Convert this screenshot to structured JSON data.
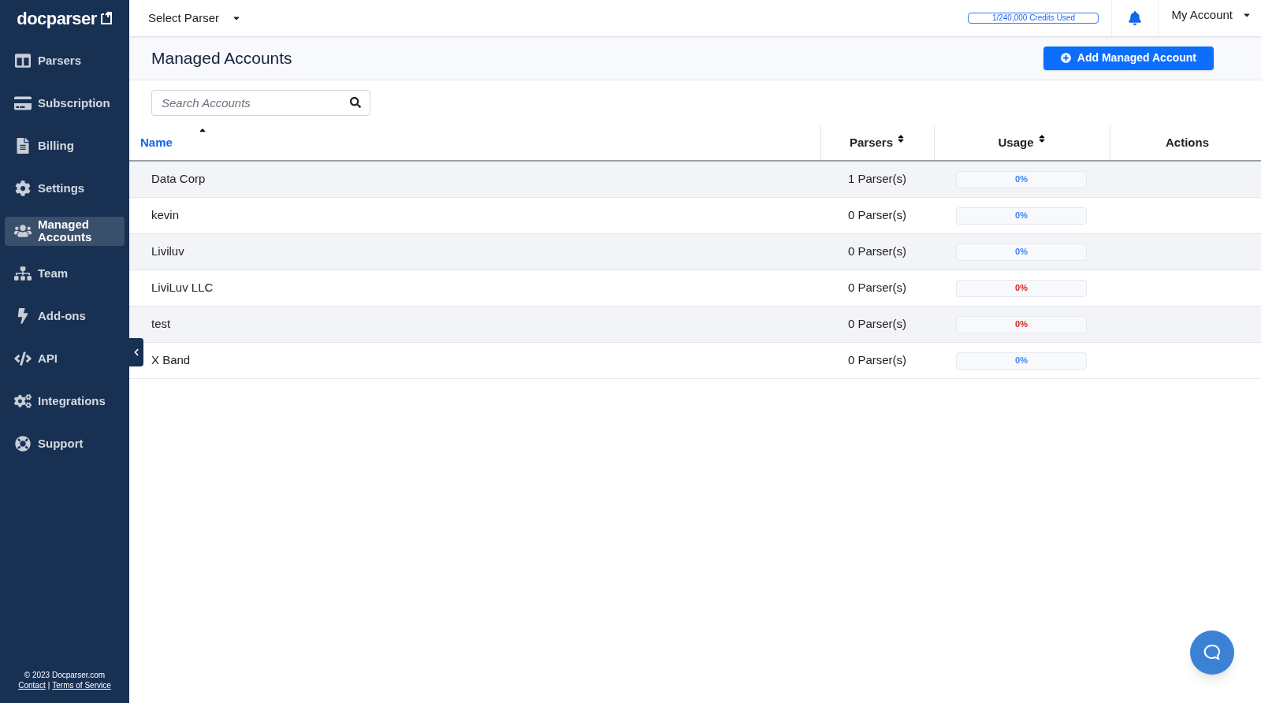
{
  "logo": "docparser",
  "sidebar": {
    "items": [
      {
        "label": "Parsers",
        "selected": false
      },
      {
        "label": "Subscription",
        "selected": false
      },
      {
        "label": "Billing",
        "selected": false
      },
      {
        "label": "Settings",
        "selected": false
      },
      {
        "label": "Managed Accounts",
        "selected": true
      },
      {
        "label": "Team",
        "selected": false
      },
      {
        "label": "Add-ons",
        "selected": false
      },
      {
        "label": "API",
        "selected": false
      },
      {
        "label": "Integrations",
        "selected": false
      },
      {
        "label": "Support",
        "selected": false
      }
    ],
    "footer": {
      "copyright": "© 2023 Docparser.com",
      "links": [
        "Contact",
        "Terms of Service"
      ],
      "separator": "|"
    }
  },
  "topbar": {
    "parser_select": "Select Parser",
    "credits": {
      "text": "1/240,000 Credits Used"
    },
    "account": "My Account"
  },
  "page": {
    "title": "Managed Accounts",
    "add_button": "Add Managed Account"
  },
  "search": {
    "placeholder": "Search Accounts"
  },
  "table": {
    "columns": [
      {
        "label": "Name",
        "sorted": true
      },
      {
        "label": "Parsers",
        "sorted": false
      },
      {
        "label": "Usage",
        "sorted": false
      },
      {
        "label": "Actions",
        "sorted": false
      }
    ],
    "rows": [
      {
        "name": "Data Corp",
        "parsers": "1 Parser(s)",
        "usage": {
          "text": "0%",
          "color": "#3b82f6"
        }
      },
      {
        "name": "kevin",
        "parsers": "0 Parser(s)",
        "usage": {
          "text": "0%",
          "color": "#3b82f6"
        }
      },
      {
        "name": "Liviluv",
        "parsers": "0 Parser(s)",
        "usage": {
          "text": "0%",
          "color": "#3b82f6"
        }
      },
      {
        "name": "LiviLuv LLC",
        "parsers": "0 Parser(s)",
        "usage": {
          "text": "0%",
          "color": "#e11d1d"
        }
      },
      {
        "name": "test",
        "parsers": "0 Parser(s)",
        "usage": {
          "text": "0%",
          "color": "#e11d1d"
        }
      },
      {
        "name": "X Band",
        "parsers": "0 Parser(s)",
        "usage": {
          "text": "0%",
          "color": "#3b82f6"
        }
      }
    ]
  }
}
